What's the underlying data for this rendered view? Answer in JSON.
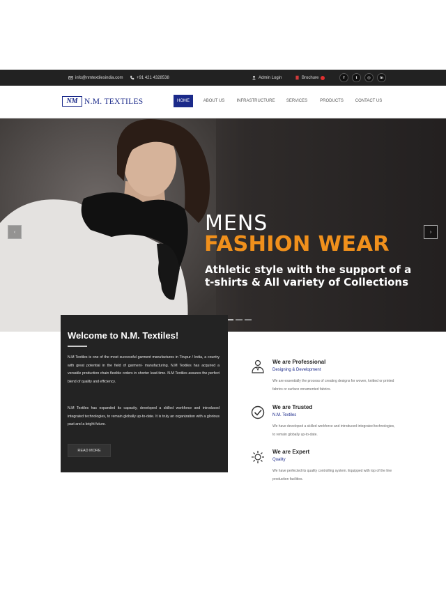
{
  "topbar": {
    "email": "info@nmtextilesindia.com",
    "phone": "+91 421 4328538",
    "admin_login": "Admin Login",
    "brochure": "Brochure",
    "social": [
      "f",
      "t",
      "◎",
      "in"
    ]
  },
  "header": {
    "logo_mark": "NM",
    "logo_text": "N.M. TEXTILES",
    "nav": [
      "HOME",
      "ABOUT US",
      "INFRASTRUCTURE",
      "SERVICES",
      "PRODUCTS",
      "CONTACT US"
    ],
    "active_nav": "HOME"
  },
  "hero": {
    "title_line1": "MENS",
    "title_line2": "FASHION WEAR",
    "subtitle": "Athletic style with the support of a t-shirts & All variety of Collections",
    "prev": "‹",
    "next": "›"
  },
  "welcome": {
    "title": "Welcome to N.M. Textiles!",
    "para1": "N.M Textiles is one of the most successful garment manufactures in Tirupur / India, a country with great potential in the field of garment- manufacturing. N.M Textiles has acquired a versatile production chain flexible orders in shorter lead-time. N.M Textiles assures the perfect blend of quality and efficiency.",
    "para2": "N.M Textiles has expanded its capacity, developed a skilled workforce and introduced integrated technologies, to remain globally up-to-date. It is truly an organization with a glorious past and a bright future.",
    "button": "READ MORE"
  },
  "features": [
    {
      "title": "We are Professional",
      "subtitle": "Designing & Development",
      "desc": "We are essentially the process of creating designs for woven, knitted or printed fabrics or surface ornamented fabrics."
    },
    {
      "title": "We are Trusted",
      "subtitle": "N.M. Textiles",
      "desc": "We have developed a skilled workforce and introduced integrated technologies, to remain globally up-to-date."
    },
    {
      "title": "We are Expert",
      "subtitle": "Quality",
      "desc": "We have perfected its quality controlling system. Equipped with top of the line production facilities."
    }
  ],
  "colors": {
    "brand_blue": "#1b2a8a",
    "accent_orange": "#f0901c",
    "dark": "#232323"
  }
}
